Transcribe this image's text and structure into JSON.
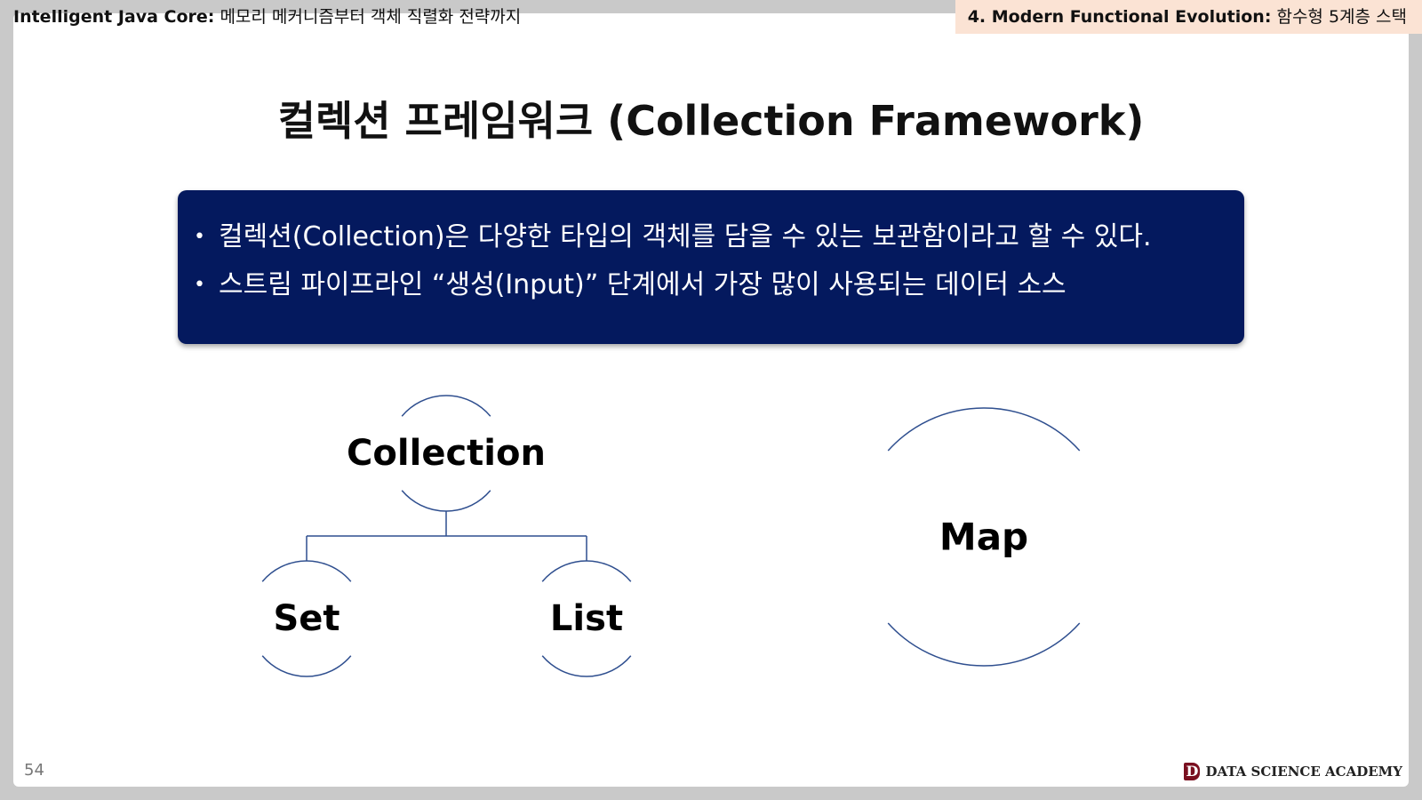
{
  "header": {
    "left_bold": "Intelligent Java Core:",
    "left_text": "메모리 메커니즘부터 객체 직렬화 전략까지",
    "right_bold": "4. Modern Functional Evolution:",
    "right_text": "함수형 5계층 스택"
  },
  "title": "컬렉션 프레임워크 (Collection Framework)",
  "info_box": {
    "bullets": [
      "컬렉션(Collection)은 다양한 타입의 객체를 담을 수 있는 보관함이라고 할 수 있다.",
      "스트림 파이프라인 “생성(Input)” 단계에서 가장 많이 사용되는 데이터 소스"
    ]
  },
  "diagram": {
    "root": "Collection",
    "children": [
      "Set",
      "List"
    ],
    "separate": "Map",
    "line_color": "#2f4f8f"
  },
  "footer": {
    "page_number": "54",
    "brand_logo": "D",
    "brand_name": "DATA SCIENCE ACADEMY"
  },
  "colors": {
    "info_box_bg": "#04195e",
    "header_right_bg": "#fbe3d4"
  }
}
